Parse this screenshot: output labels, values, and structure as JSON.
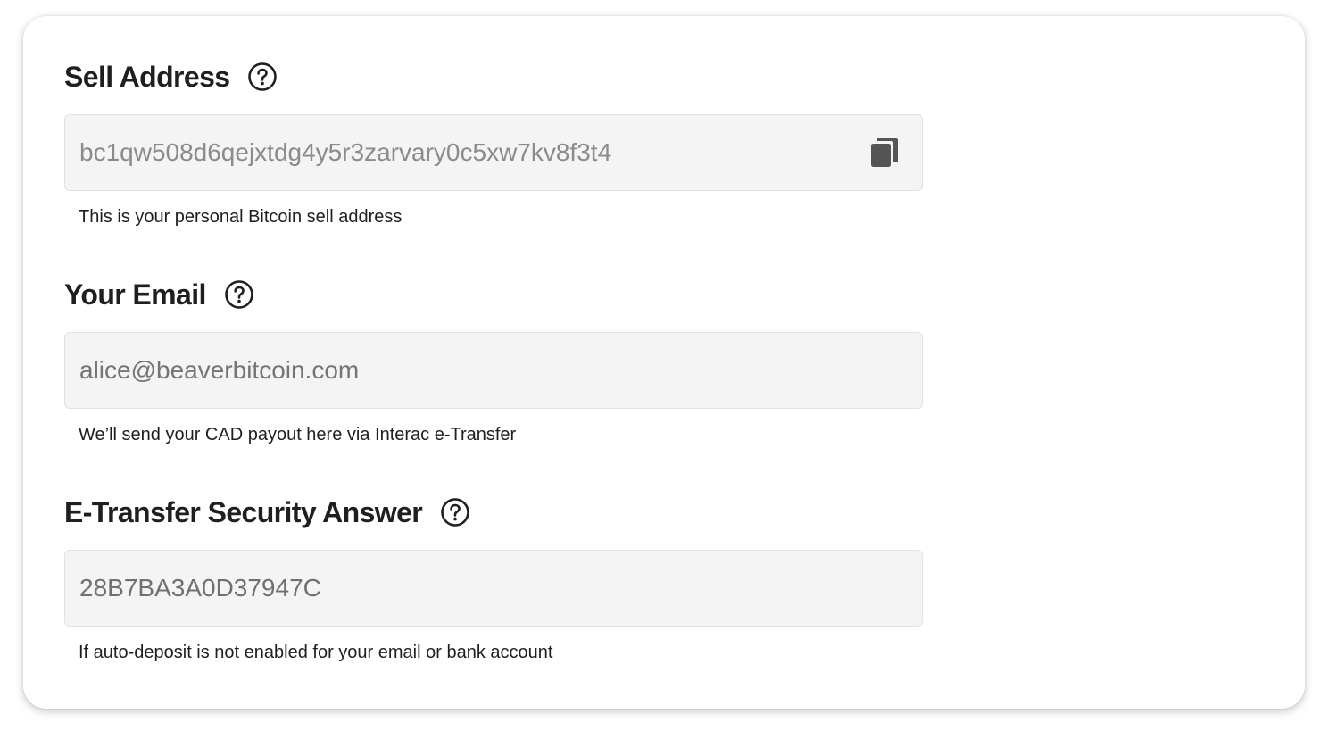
{
  "sell_address": {
    "label": "Sell Address",
    "help_icon": "question-circle-icon",
    "value": "bc1qw508d6qejxtdg4y5r3zarvary0c5xw7kv8f3t4",
    "copy_icon": "copy-icon",
    "hint": "This is your personal Bitcoin sell address"
  },
  "email": {
    "label": "Your Email",
    "help_icon": "question-circle-icon",
    "placeholder": "alice@beaverbitcoin.com",
    "hint": "We’ll send your CAD payout here via Interac e-Transfer"
  },
  "security_answer": {
    "label": "E-Transfer Security Answer",
    "help_icon": "question-circle-icon",
    "value": "28B7BA3A0D37947C",
    "hint": "If auto-deposit is not enabled for your email or bank account"
  },
  "colors": {
    "text": "#1f1f1f",
    "field_bg": "#f4f4f4",
    "field_text": "#8b8b8b",
    "icon": "#555555"
  }
}
